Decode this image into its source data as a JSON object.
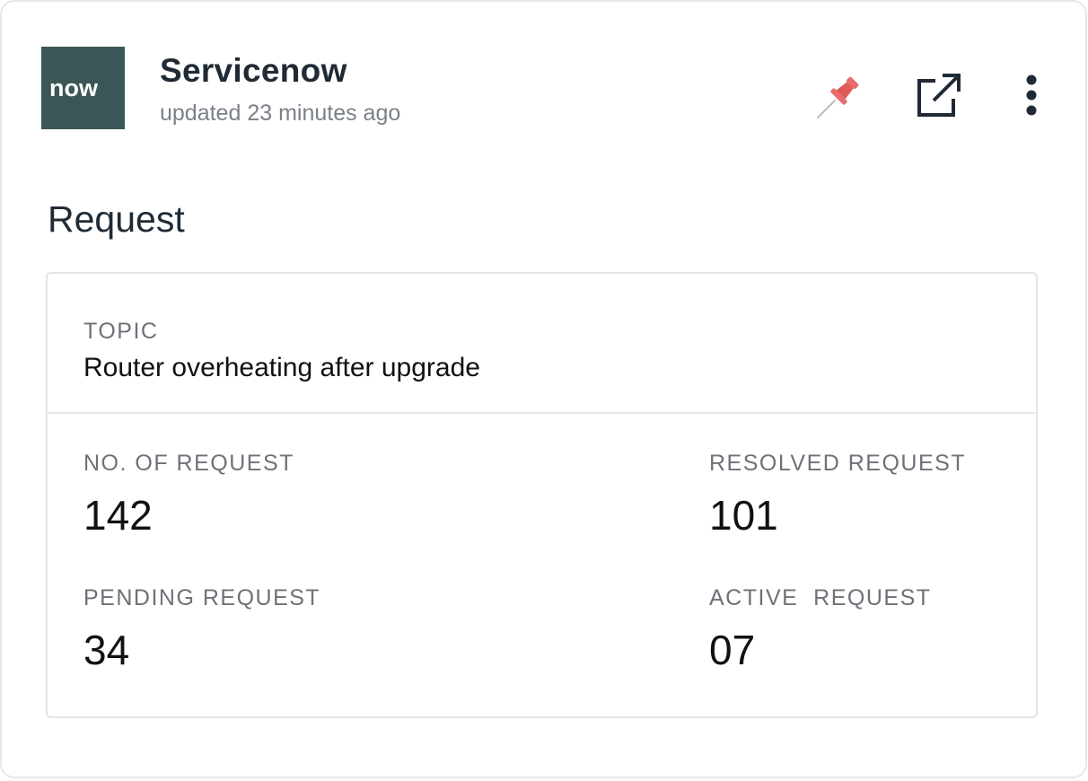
{
  "header": {
    "logo_text": "now",
    "title": "Servicenow",
    "updated": "updated 23 minutes ago",
    "actions": [
      {
        "icon": "pin-icon",
        "color": "#e05a5a"
      },
      {
        "icon": "open-external-icon",
        "color": "#1f2a35"
      },
      {
        "icon": "more-vertical-icon",
        "color": "#1f2a35"
      }
    ]
  },
  "section": {
    "title": "Request"
  },
  "topic": {
    "label": "TOPIC",
    "value": "Router overheating after upgrade"
  },
  "stats": {
    "total": {
      "label": "NO. OF REQUEST",
      "value": "142"
    },
    "resolved": {
      "label": "RESOLVED REQUEST",
      "value": "101"
    },
    "pending": {
      "label": "PENDING REQUEST",
      "value": "34"
    },
    "active": {
      "label": "ACTIVE  REQUEST",
      "value": "07"
    }
  },
  "colors": {
    "logo_bg": "#3b5656",
    "pin": "#e05a5a",
    "text_dark": "#1f2a35",
    "text_muted": "#7b8089"
  }
}
